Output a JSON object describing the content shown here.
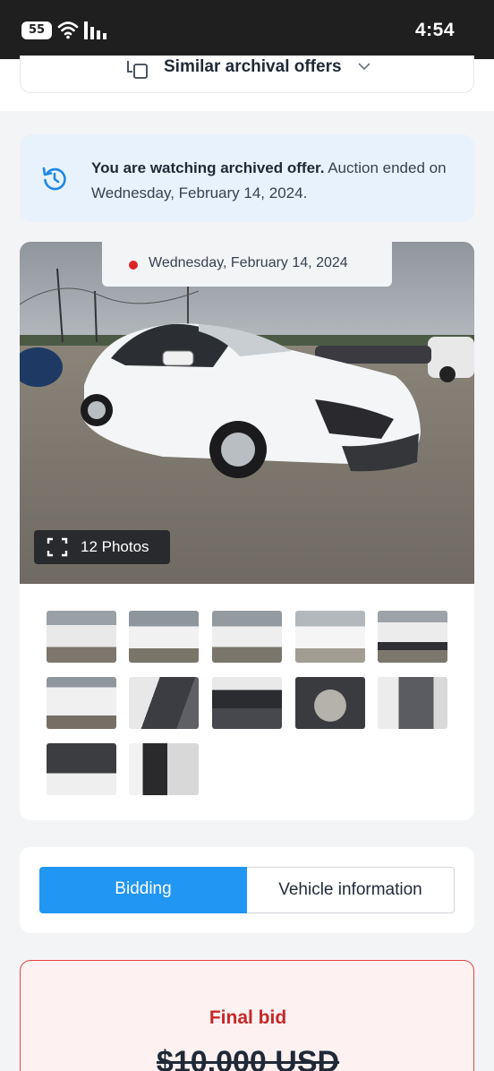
{
  "status_bar": {
    "battery": "55",
    "time": "4:54"
  },
  "similar": {
    "label": "Similar archival offers"
  },
  "notice": {
    "strong": "You are watching archived offer.",
    "text": " Auction ended on Wednesday, February 14, 2024."
  },
  "gallery": {
    "date": "Wednesday, February 14, 2024",
    "photos_label": "12 Photos",
    "thumbnails": [
      "front-left",
      "left",
      "left-side",
      "front",
      "front-close",
      "rear",
      "interior-front",
      "dashboard",
      "console",
      "rear-seats",
      "engine-bay",
      "door-jamb"
    ]
  },
  "tabs": [
    {
      "label": "Bidding"
    },
    {
      "label": "Vehicle information"
    }
  ],
  "bid": {
    "label": "Final bid",
    "amount": "$10,000 USD"
  },
  "colors": {
    "accent": "#2196f3",
    "danger": "#c62828",
    "notice_bg": "#e8f2fc"
  }
}
